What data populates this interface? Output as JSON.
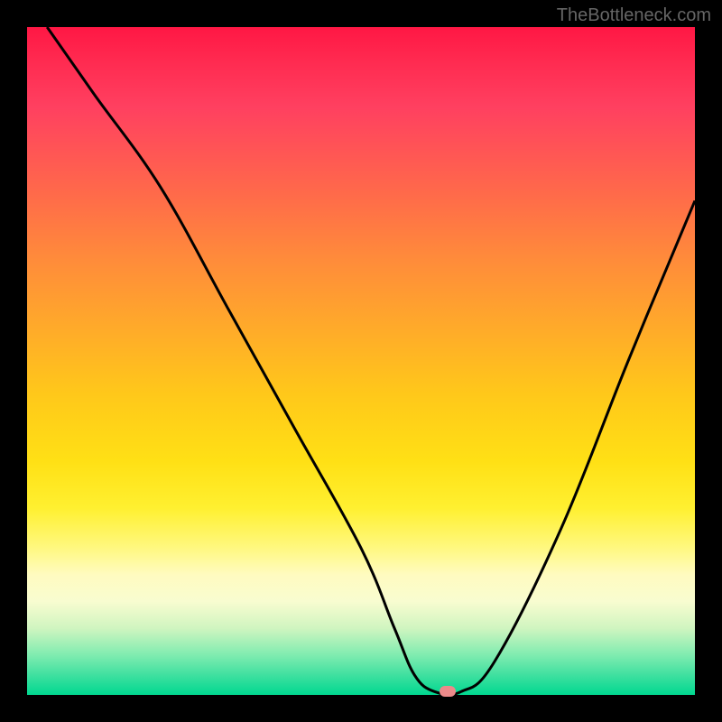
{
  "watermark": "TheBottleneck.com",
  "chart_data": {
    "type": "line",
    "title": "",
    "xlabel": "",
    "ylabel": "",
    "xlim": [
      0,
      100
    ],
    "ylim": [
      0,
      100
    ],
    "x": [
      3,
      10,
      20,
      30,
      40,
      50,
      55,
      58,
      61,
      65,
      70,
      80,
      90,
      100
    ],
    "values": [
      100,
      90,
      76,
      58,
      40,
      22,
      10,
      3,
      0.5,
      0.5,
      5,
      25,
      50,
      74
    ],
    "marker_x": 63,
    "marker_y": 0.5,
    "background_gradient": {
      "top": "#ff1744",
      "mid_upper": "#ff8c3a",
      "mid": "#ffe015",
      "mid_lower": "#fff880",
      "bottom": "#00d890"
    },
    "curve_color": "#000000",
    "marker_color": "#ec8a8a"
  }
}
